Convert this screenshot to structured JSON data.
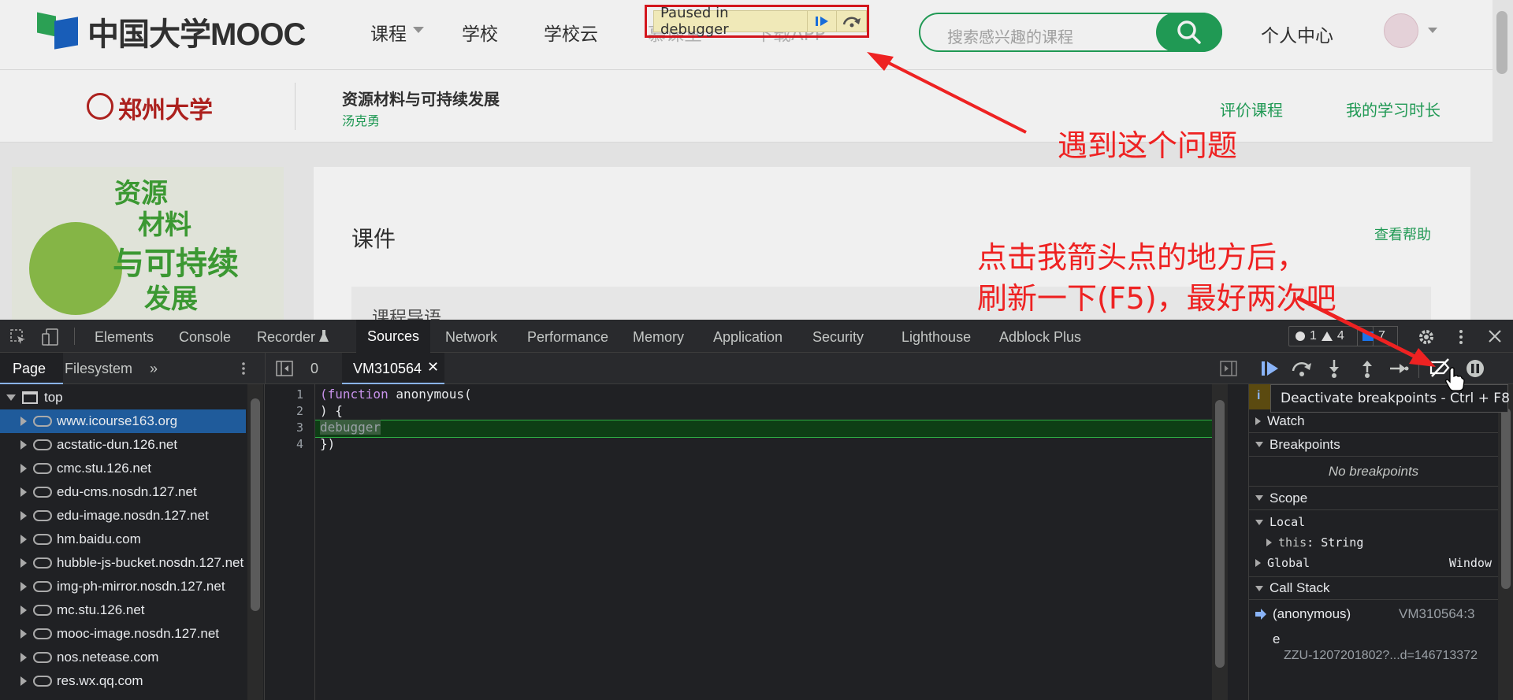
{
  "site": {
    "logo_text": "中国大学MOOC",
    "nav": [
      "课程",
      "学校",
      "学校云",
      "慕课堂",
      "下载APP"
    ],
    "search_placeholder": "搜索感兴趣的课程",
    "user_center": "个人中心"
  },
  "debugger_banner": {
    "label": "Paused in debugger"
  },
  "course": {
    "school": "郑州大学",
    "title": "资源材料与可持续发展",
    "teacher": "汤克勇",
    "links": [
      "评价课程",
      "我的学习时长"
    ],
    "cover_lines": [
      "资源",
      "材料",
      "与可持续",
      "发展"
    ],
    "section_title": "课件",
    "help": "查看帮助",
    "chapter": "课程导语"
  },
  "annotations": {
    "problem": "遇到这个问题",
    "instruction_1": "点击我箭头点的地方后，",
    "instruction_2": "刷新一下(F5)，最好两次吧"
  },
  "devtools": {
    "tabs": [
      "Elements",
      "Console",
      "Recorder",
      "Sources",
      "Network",
      "Performance",
      "Memory",
      "Application",
      "Security",
      "Lighthouse",
      "Adblock Plus"
    ],
    "active_tab": "Sources",
    "counts": {
      "errors": "1",
      "warnings": "4",
      "info": "7"
    },
    "nav_tabs": [
      "Page",
      "Filesystem"
    ],
    "file_tabs": [
      "0",
      "VM310564"
    ],
    "tree_root": "top",
    "tree_items": [
      "www.icourse163.org",
      "acstatic-dun.126.net",
      "cmc.stu.126.net",
      "edu-cms.nosdn.127.net",
      "edu-image.nosdn.127.net",
      "hm.baidu.com",
      "hubble-js-bucket.nosdn.127.net",
      "img-ph-mirror.nosdn.127.net",
      "mc.stu.126.net",
      "mooc-image.nosdn.127.net",
      "nos.netease.com",
      "res.wx.qq.com"
    ],
    "code_lines": [
      {
        "n": "1",
        "kw": "(function",
        "rest": " anonymous("
      },
      {
        "n": "2",
        "kw": "",
        "rest": ") {"
      },
      {
        "n": "3",
        "kw": "",
        "rest": "debugger"
      },
      {
        "n": "4",
        "kw": "",
        "rest": "})"
      }
    ],
    "tooltip": "Deactivate breakpoints - Ctrl + F8",
    "panes": {
      "watch": "Watch",
      "breakpoints": "Breakpoints",
      "no_breakpoints": "No breakpoints",
      "scope": "Scope",
      "local": "Local",
      "this_key": "this",
      "this_val": "String",
      "global": "Global",
      "global_val": "Window",
      "callstack": "Call Stack",
      "frame1_name": "(anonymous)",
      "frame1_loc": "VM310564:3",
      "frame2_name": "e",
      "frame2_loc": "ZZU-1207201802?...d=146713372"
    }
  }
}
